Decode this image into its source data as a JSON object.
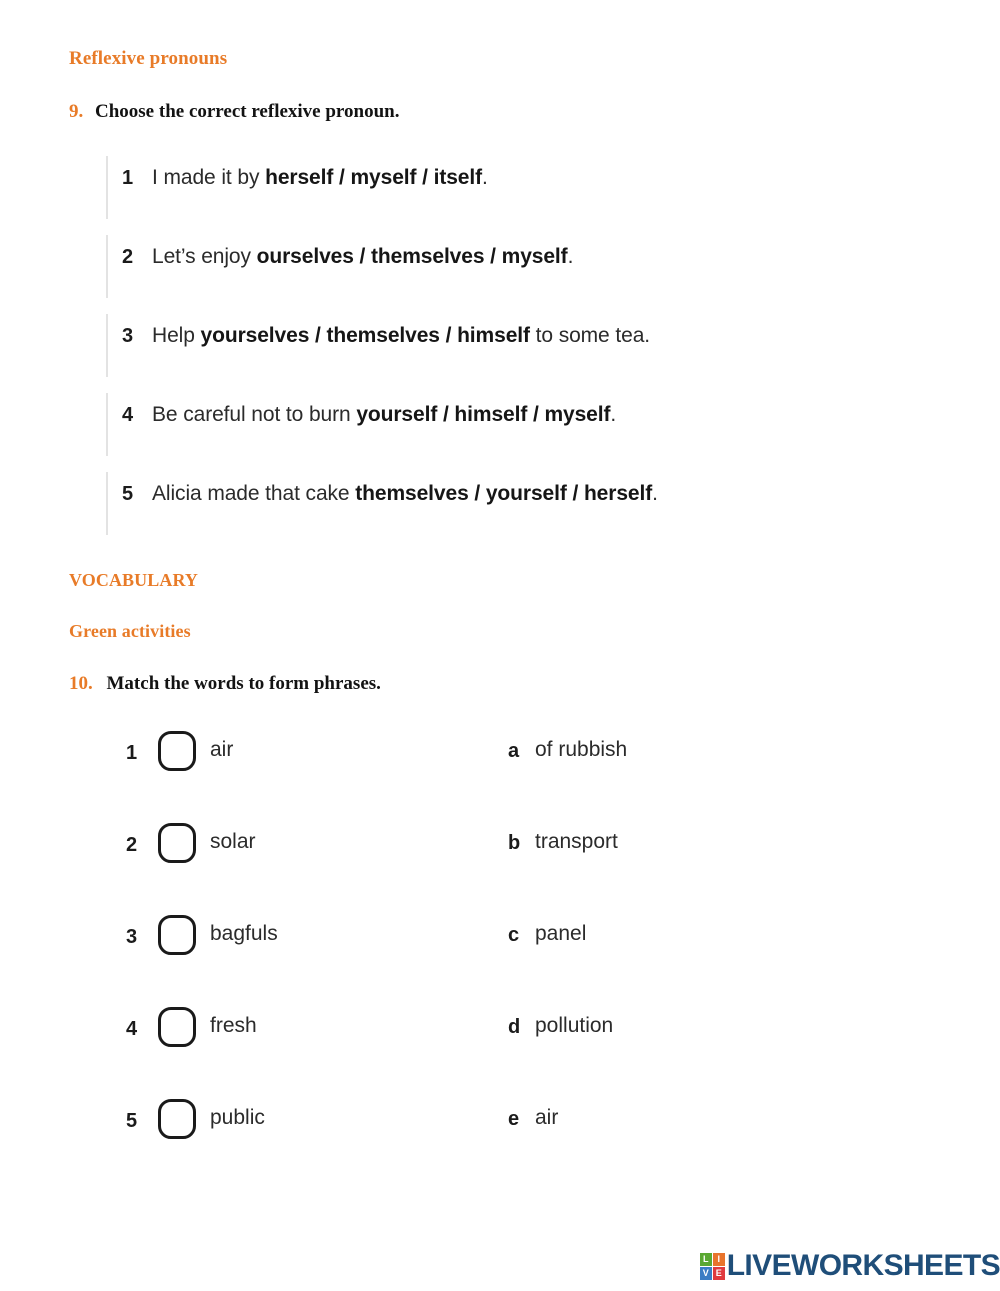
{
  "colors": {
    "heading_orange": "#e87b28",
    "body_text": "#2b2b2b",
    "number_black": "#1b1b1b",
    "logo_navy": "#1f4e79",
    "rule_gray": "#e3e3e3",
    "box_border": "#1a1a1a"
  },
  "headings": {
    "reflexive_pronouns": "Reflexive pronouns",
    "vocabulary": "VOCABULARY",
    "green_activities": "Green activities"
  },
  "exercise9": {
    "number": "9.",
    "instruction": "Choose the correct reflexive pronoun.",
    "items": [
      {
        "number": "1",
        "pre": "I made it by ",
        "options": "herself / myself / itself",
        "post": "."
      },
      {
        "number": "2",
        "pre": "Let’s enjoy ",
        "options": "ourselves / themselves / myself",
        "post": "."
      },
      {
        "number": "3",
        "pre": "Help ",
        "options": "yourselves / themselves / himself",
        "post": " to some tea."
      },
      {
        "number": "4",
        "pre": "Be careful not to burn ",
        "options": "yourself / himself / myself",
        "post": "."
      },
      {
        "number": "5",
        "pre": "Alicia made that cake ",
        "options": "themselves / yourself / herself",
        "post": "."
      }
    ]
  },
  "exercise10": {
    "number": "10.",
    "instruction": "Match the words to form phrases.",
    "items": [
      {
        "number": "1",
        "word": "air",
        "answer": "",
        "letter": "a",
        "phrase": "of rubbish"
      },
      {
        "number": "2",
        "word": "solar",
        "answer": "",
        "letter": "b",
        "phrase": "transport"
      },
      {
        "number": "3",
        "word": "bagfuls",
        "answer": "",
        "letter": "c",
        "phrase": "panel"
      },
      {
        "number": "4",
        "word": "fresh",
        "answer": "",
        "letter": "d",
        "phrase": "pollution"
      },
      {
        "number": "5",
        "word": "public",
        "answer": "",
        "letter": "e",
        "phrase": "air"
      }
    ]
  },
  "footer": {
    "logo_tiles": [
      {
        "letter": "L",
        "color": "#5aa832"
      },
      {
        "letter": "I",
        "color": "#e8742c"
      },
      {
        "letter": "V",
        "color": "#3b7dc4"
      },
      {
        "letter": "E",
        "color": "#e03a3f"
      }
    ],
    "logo_word": "LIVEWORKSHEETS"
  }
}
